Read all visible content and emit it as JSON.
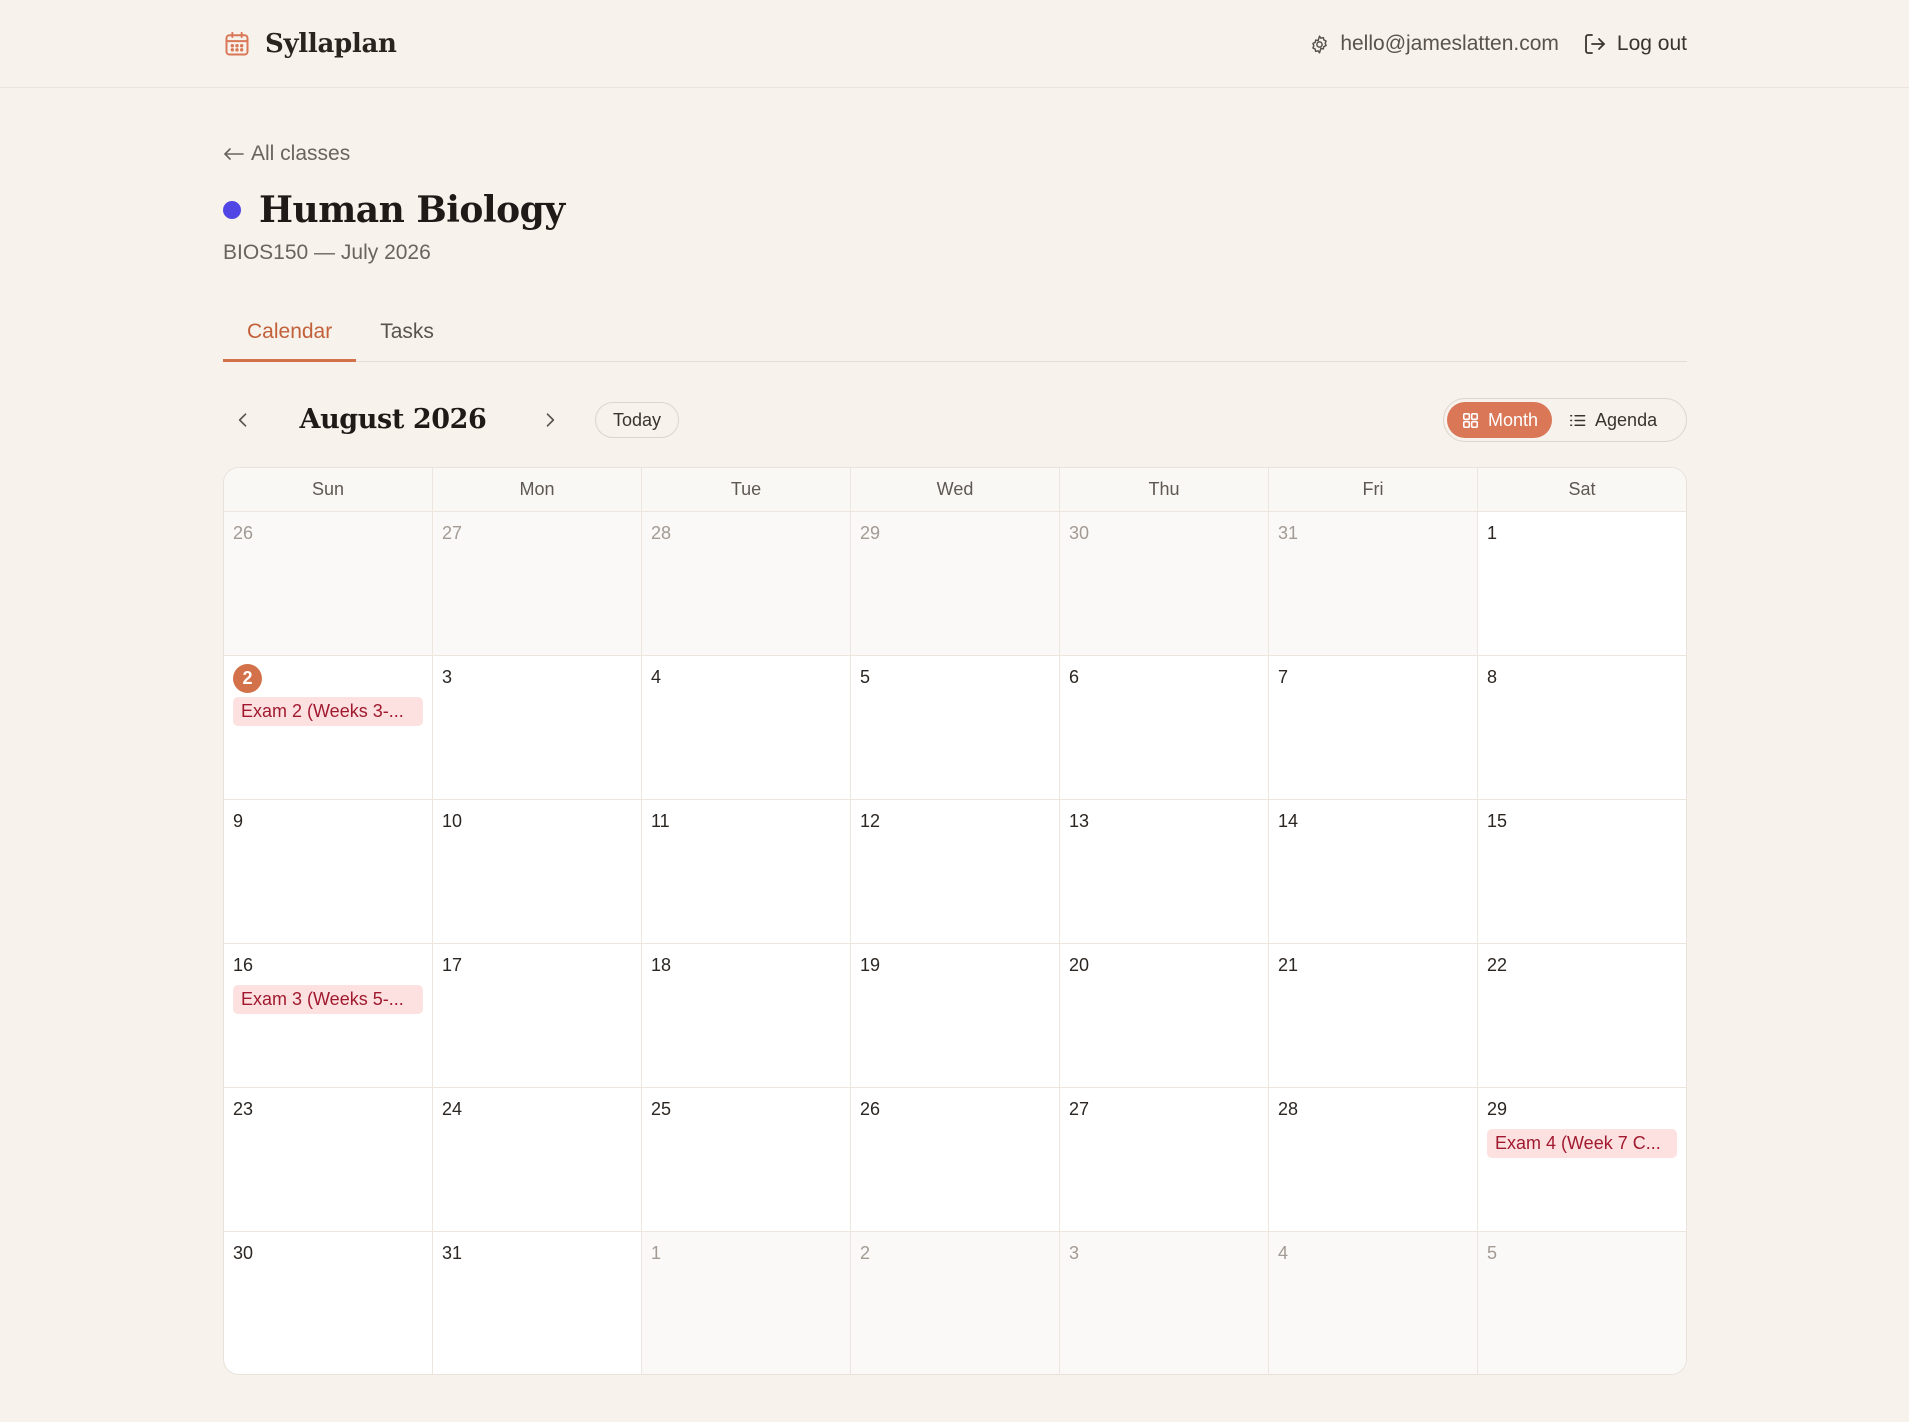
{
  "app": {
    "name": "Syllaplan",
    "user_email": "hello@jameslatten.com",
    "logout_label": "Log out"
  },
  "page": {
    "back_label": "All classes",
    "class_title": "Human Biology",
    "class_color": "#4f46e5",
    "subtitle": "BIOS150 — July 2026"
  },
  "tabs": [
    {
      "label": "Calendar",
      "active": true
    },
    {
      "label": "Tasks",
      "active": false
    }
  ],
  "toolbar": {
    "month_label": "August 2026",
    "today_label": "Today",
    "view_month_label": "Month",
    "view_agenda_label": "Agenda",
    "active_view": "Month"
  },
  "calendar": {
    "weekdays": [
      "Sun",
      "Mon",
      "Tue",
      "Wed",
      "Thu",
      "Fri",
      "Sat"
    ],
    "weeks": [
      [
        {
          "d": "26",
          "outside": true
        },
        {
          "d": "27",
          "outside": true
        },
        {
          "d": "28",
          "outside": true
        },
        {
          "d": "29",
          "outside": true
        },
        {
          "d": "30",
          "outside": true
        },
        {
          "d": "31",
          "outside": true
        },
        {
          "d": "1"
        }
      ],
      [
        {
          "d": "2",
          "today": true,
          "events": [
            "Exam 2 (Weeks 3-..."
          ]
        },
        {
          "d": "3"
        },
        {
          "d": "4"
        },
        {
          "d": "5"
        },
        {
          "d": "6"
        },
        {
          "d": "7"
        },
        {
          "d": "8"
        }
      ],
      [
        {
          "d": "9"
        },
        {
          "d": "10"
        },
        {
          "d": "11"
        },
        {
          "d": "12"
        },
        {
          "d": "13"
        },
        {
          "d": "14"
        },
        {
          "d": "15"
        }
      ],
      [
        {
          "d": "16",
          "events": [
            "Exam 3 (Weeks 5-..."
          ]
        },
        {
          "d": "17"
        },
        {
          "d": "18"
        },
        {
          "d": "19"
        },
        {
          "d": "20"
        },
        {
          "d": "21"
        },
        {
          "d": "22"
        }
      ],
      [
        {
          "d": "23"
        },
        {
          "d": "24"
        },
        {
          "d": "25"
        },
        {
          "d": "26"
        },
        {
          "d": "27"
        },
        {
          "d": "28"
        },
        {
          "d": "29",
          "events": [
            "Exam 4 (Week 7 C..."
          ]
        }
      ],
      [
        {
          "d": "30"
        },
        {
          "d": "31"
        },
        {
          "d": "1",
          "outside": true
        },
        {
          "d": "2",
          "outside": true
        },
        {
          "d": "3",
          "outside": true
        },
        {
          "d": "4",
          "outside": true
        },
        {
          "d": "5",
          "outside": true
        }
      ]
    ]
  },
  "icons": {
    "brand": "calendar-icon",
    "account": "gear-icon",
    "logout": "logout-icon",
    "back": "arrow-left-icon",
    "prev": "chevron-left-icon",
    "next": "chevron-right-icon",
    "month_view": "grid-icon",
    "agenda_view": "list-icon"
  },
  "colors": {
    "accent": "#d97757",
    "background": "#f7f2ec",
    "event_bg": "#fde1e1",
    "event_text": "#a0192e"
  }
}
